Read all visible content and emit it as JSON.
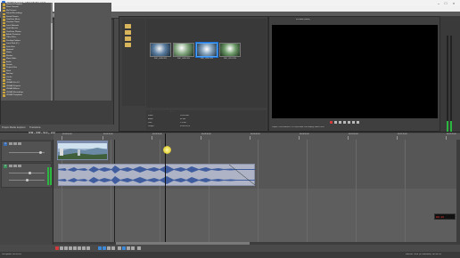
{
  "window": {
    "title": "Untitled.veg * - VEGAS Pro 14.0"
  },
  "menu": [
    "File",
    "Edit",
    "View",
    "Insert",
    "Tools",
    "Options",
    "Help"
  ],
  "explorer": {
    "tree_items": [
      "Movies & Dropbox",
      "Music Sounds",
      "My Pictures",
      "Sound Recordings",
      "Saved Games",
      "OneDrive Music",
      "Creative Cloud",
      "Local Network",
      "Quick Access",
      "OneDrive Photos",
      "Adobe Premiere",
      "Video Files",
      "Desktop Folders",
      "Local Disk (C:)",
      "Data Files",
      "Network",
      "Media",
      "Render",
      "Music Edits",
      "Audio",
      "Scripts",
      "Project Files",
      "Work",
      "Backup",
      "Cache",
      "Temp",
      "VEGAS Pro 14",
      "VEGAS Projects",
      "VEGAS Effects",
      "VEGAS Recordings",
      "VEGAS Templates"
    ],
    "tabs": [
      "Project Media",
      "Explorer",
      "Transitions"
    ]
  },
  "media": {
    "clips": [
      {
        "label": "DSC_0248.JPG"
      },
      {
        "label": "DSC_0249.JPG"
      },
      {
        "label": "DSC_0250.JPG"
      },
      {
        "label": "DSC_0251.JPG"
      }
    ],
    "info_labels": [
      "Video:",
      "Audio:",
      "Size:",
      "Length:"
    ],
    "info_values": [
      "1920x1080",
      "48 kHz",
      "2.4 MB",
      "00:00:05;00"
    ],
    "info_header": "Image: 1920x1080x32, 29.970 fps | Audio: 48,000 Hz, 16 bit, Stereo"
  },
  "preview": {
    "label": "Preview (Auto)",
    "status": "Project: 1920x1080x32, 29.970p  Frame: 436  Display: 480x270x32"
  },
  "timeline": {
    "timecode": "00:00:03;16",
    "ruler": [
      "00:00:00;00",
      "00:00:10;00",
      "00:00:20;00",
      "00:00:30;00",
      "00:00:40;00",
      "00:00:50;00",
      "00:01:00;00",
      "00:01:10;00",
      "00:01:20;00"
    ],
    "tracks": [
      {
        "number": "1"
      },
      {
        "number": "2"
      }
    ]
  },
  "status": {
    "left": "Complete: 00:00:01",
    "right": "Record Time (2 channels): 62:44:55"
  },
  "rec_counter": "00:15"
}
